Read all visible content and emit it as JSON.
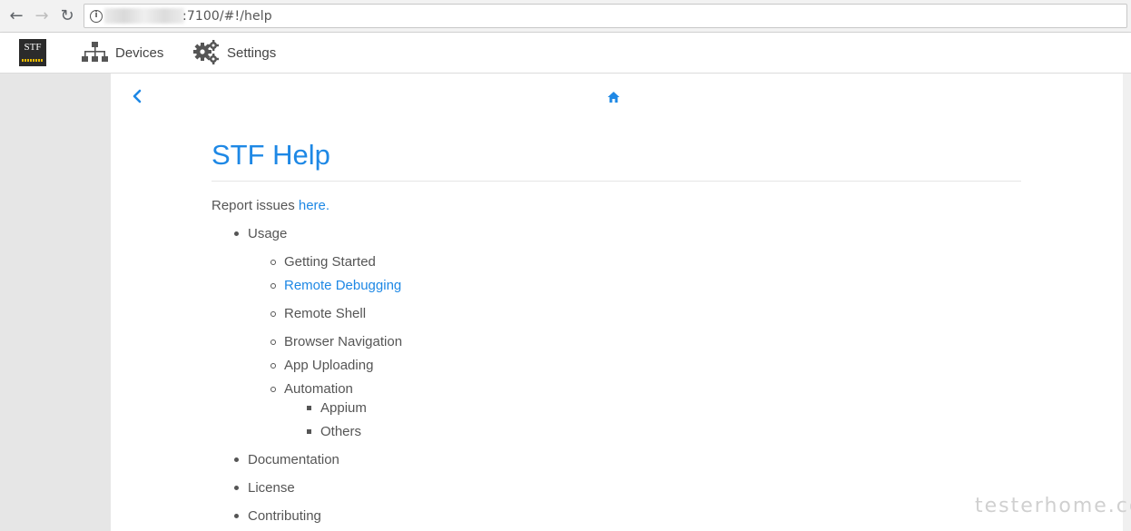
{
  "browser": {
    "url_text": ":7100/#!/help"
  },
  "appbar": {
    "logo_text": "STF",
    "nav": [
      {
        "label": "Devices"
      },
      {
        "label": "Settings"
      }
    ]
  },
  "help": {
    "title": "STF Help",
    "report_prefix": "Report issues ",
    "report_link": "here",
    "report_suffix": ".",
    "items": {
      "usage": "Usage",
      "getting_started": "Getting Started",
      "remote_debugging": "Remote Debugging",
      "remote_shell": "Remote Shell",
      "browser_navigation": "Browser Navigation",
      "app_uploading": "App Uploading",
      "automation": "Automation",
      "appium": "Appium",
      "others": "Others",
      "documentation": "Documentation",
      "license": "License",
      "contributing": "Contributing"
    }
  },
  "watermark": "testerhome.com",
  "colors": {
    "accent": "#1e88e5",
    "text": "#555555"
  }
}
